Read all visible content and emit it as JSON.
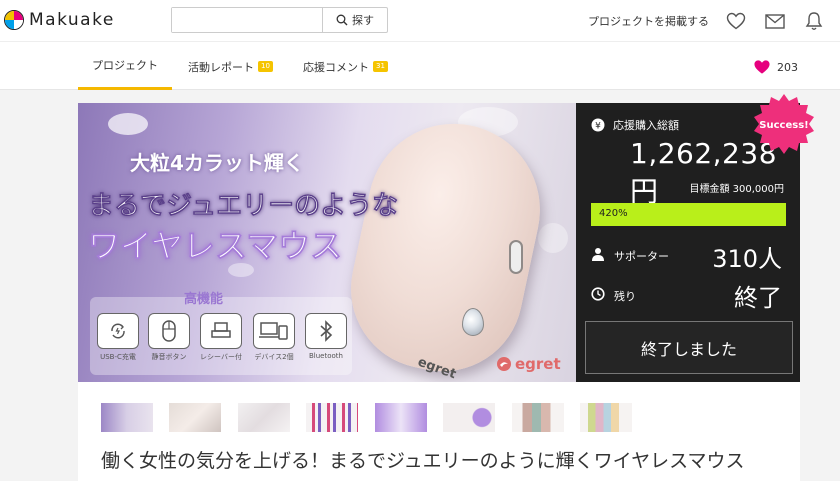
{
  "brand": {
    "name": "Makuake"
  },
  "header": {
    "search_placeholder": "",
    "search_button": "探す",
    "post_project_link": "プロジェクトを掲載する"
  },
  "tabs": [
    {
      "label": "プロジェクト",
      "badge": null,
      "active": true
    },
    {
      "label": "活動レポート",
      "badge": "10",
      "active": false
    },
    {
      "label": "応援コメント",
      "badge": "31",
      "active": false
    }
  ],
  "like": {
    "count": "203"
  },
  "hero": {
    "line1": "大粒4カラット輝く",
    "line2": "まるでジュエリーのような",
    "line3": "ワイヤレスマウス",
    "features_title": "高機能",
    "features": [
      {
        "label": "USB-C充電",
        "icon": "usb-c-charge-icon"
      },
      {
        "label": "静音ボタン",
        "icon": "silent-mouse-icon"
      },
      {
        "label": "レシーバー付",
        "icon": "receiver-icon"
      },
      {
        "label": "デバイス2個",
        "icon": "two-devices-icon"
      },
      {
        "label": "Bluetooth",
        "icon": "bluetooth-icon"
      }
    ],
    "product_brand": "egret"
  },
  "funding": {
    "total_label": "応援購入総額",
    "currency_symbol": "¥",
    "total_amount": "1,262,238円",
    "goal_label": "目標金額 300,000円",
    "progress_label": "420%",
    "progress_percent": 420,
    "supporters_label": "サポーター",
    "supporters_value": "310人",
    "remaining_label": "残り",
    "remaining_value": "終了",
    "ended_button": "終了しました",
    "success_badge": "Success!"
  },
  "project_title": "働く女性の気分を上げる！まるでジュエリーのように輝くワイヤレスマウス",
  "colors": {
    "accent_yellow": "#f5b800",
    "progress_green": "#b9ef1a",
    "heart_pink": "#e6007e",
    "success_pink": "#ee2f7b",
    "panel_dark": "#1f1f1f"
  }
}
